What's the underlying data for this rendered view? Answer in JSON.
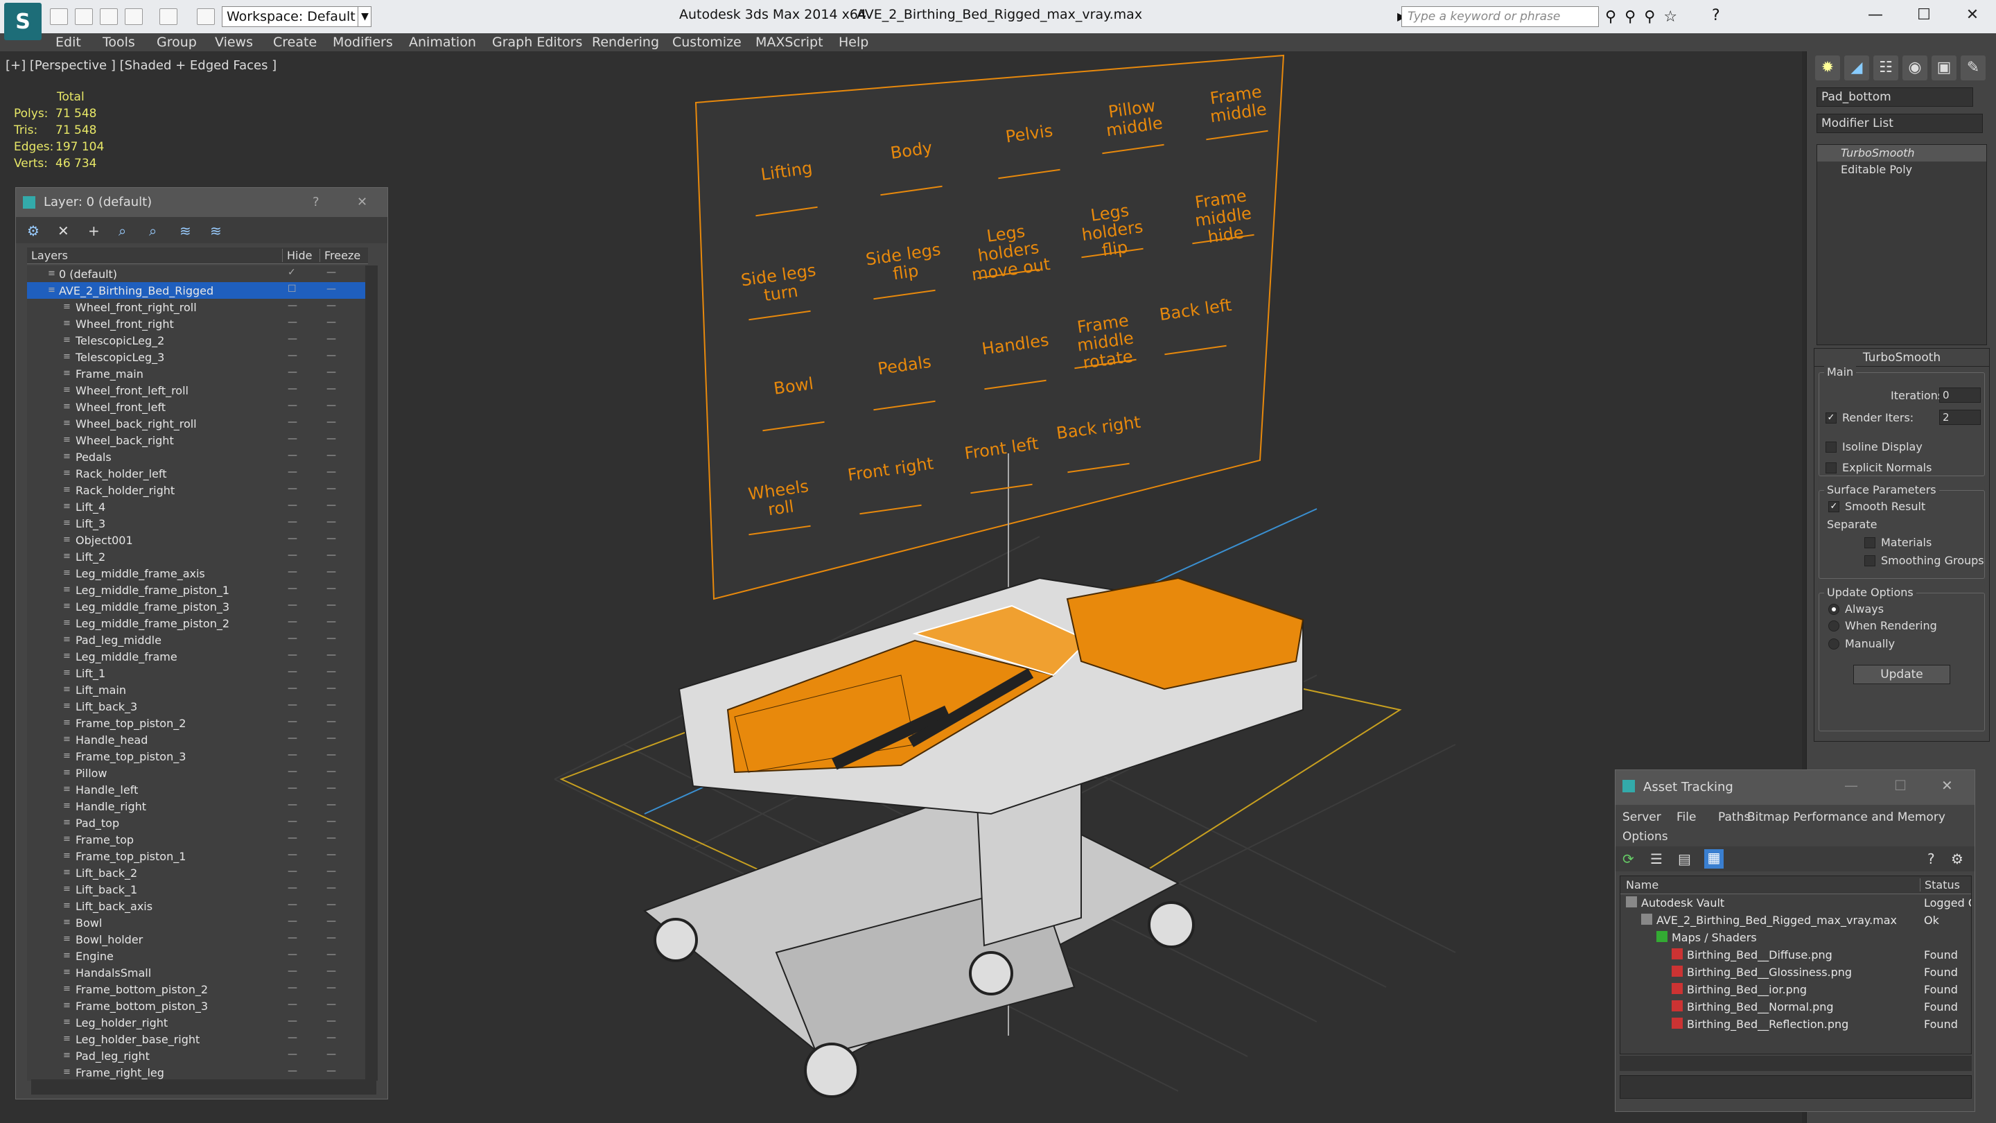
{
  "titlebar": {
    "workspace": "Workspace: Default",
    "app_title": "Autodesk 3ds Max  2014 x64",
    "doc_title": "AVE_2_Birthing_Bed_Rigged_max_vray.max",
    "search_placeholder": "Type a keyword or phrase"
  },
  "menu": [
    "Edit",
    "Tools",
    "Group",
    "Views",
    "Create",
    "Modifiers",
    "Animation",
    "Graph Editors",
    "Rendering",
    "Customize",
    "MAXScript",
    "Help"
  ],
  "viewport": {
    "label": "[+] [Perspective ] [Shaded + Edged Faces ]",
    "stats": {
      "total_label": "Total",
      "polys_label": "Polys:",
      "polys": "71 548",
      "tris_label": "Tris:",
      "tris": "71 548",
      "edges_label": "Edges:",
      "edges": "197 104",
      "verts_label": "Verts:",
      "verts": "46 734"
    },
    "controls": [
      "Lifting",
      "Body",
      "Pelvis",
      "Pillow middle",
      "Frame middle",
      "Side legs turn",
      "Side legs flip",
      "Legs holders move out",
      "Legs holders flip",
      "Frame middle hide",
      "Bowl",
      "Pedals",
      "Handles",
      "Frame middle rotate",
      "Back left",
      "Wheels roll",
      "Front right",
      "Front left",
      "Back right"
    ]
  },
  "layer_panel": {
    "title": "Layer: 0 (default)",
    "help": "?",
    "close": "✕",
    "col_layers": "Layers",
    "col_hide": "Hide",
    "col_freeze": "Freeze",
    "layers": [
      "0 (default)",
      "AVE_2_Birthing_Bed_Rigged",
      "Wheel_front_right_roll",
      "Wheel_front_right",
      "TelescopicLeg_2",
      "TelescopicLeg_3",
      "Frame_main",
      "Wheel_front_left_roll",
      "Wheel_front_left",
      "Wheel_back_right_roll",
      "Wheel_back_right",
      "Pedals",
      "Rack_holder_left",
      "Rack_holder_right",
      "Lift_4",
      "Lift_3",
      "Object001",
      "Lift_2",
      "Leg_middle_frame_axis",
      "Leg_middle_frame_piston_1",
      "Leg_middle_frame_piston_3",
      "Leg_middle_frame_piston_2",
      "Pad_leg_middle",
      "Leg_middle_frame",
      "Lift_1",
      "Lift_main",
      "Lift_back_3",
      "Frame_top_piston_2",
      "Handle_head",
      "Frame_top_piston_3",
      "Pillow",
      "Handle_left",
      "Handle_right",
      "Pad_top",
      "Frame_top",
      "Frame_top_piston_1",
      "Lift_back_2",
      "Lift_back_1",
      "Lift_back_axis",
      "Bowl",
      "Bowl_holder",
      "Engine",
      "HandalsSmall",
      "Frame_bottom_piston_2",
      "Frame_bottom_piston_3",
      "Leg_holder_right",
      "Leg_holder_base_right",
      "Pad_leg_right",
      "Frame_right_leg"
    ]
  },
  "command_panel": {
    "object_name": "Pad_bottom",
    "modifier_list": "Modifier List",
    "stack": [
      "TurboSmooth",
      "Editable Poly"
    ],
    "turbosmooth": {
      "title": "TurboSmooth",
      "main": "Main",
      "iterations_label": "Iterations:",
      "iterations": "0",
      "render_iters_label": "Render Iters:",
      "render_iters": "2",
      "isoline": "Isoline Display",
      "explicit": "Explicit Normals",
      "surface": "Surface Parameters",
      "smooth_result": "Smooth Result",
      "separate": "Separate",
      "materials": "Materials",
      "smoothing_groups": "Smoothing Groups",
      "update_options": "Update Options",
      "always": "Always",
      "when_rendering": "When Rendering",
      "manually": "Manually",
      "update": "Update"
    }
  },
  "asset_panel": {
    "title": "Asset Tracking",
    "menus": [
      "Server",
      "File",
      "Paths",
      "Bitmap Performance and Memory",
      "Options"
    ],
    "col_name": "Name",
    "col_status": "Status",
    "rows": [
      {
        "name": "Autodesk Vault",
        "status": "Logged O",
        "indent": 0
      },
      {
        "name": "AVE_2_Birthing_Bed_Rigged_max_vray.max",
        "status": "Ok",
        "indent": 1
      },
      {
        "name": "Maps / Shaders",
        "status": "",
        "indent": 2
      },
      {
        "name": "Birthing_Bed__Diffuse.png",
        "status": "Found",
        "indent": 3
      },
      {
        "name": "Birthing_Bed__Glossiness.png",
        "status": "Found",
        "indent": 3
      },
      {
        "name": "Birthing_Bed__ior.png",
        "status": "Found",
        "indent": 3
      },
      {
        "name": "Birthing_Bed__Normal.png",
        "status": "Found",
        "indent": 3
      },
      {
        "name": "Birthing_Bed__Reflection.png",
        "status": "Found",
        "indent": 3
      }
    ]
  },
  "colors": {
    "accent_orange": "#e8890c",
    "selection_blue": "#1f5fbe",
    "stats_yellow": "#e8e867"
  }
}
